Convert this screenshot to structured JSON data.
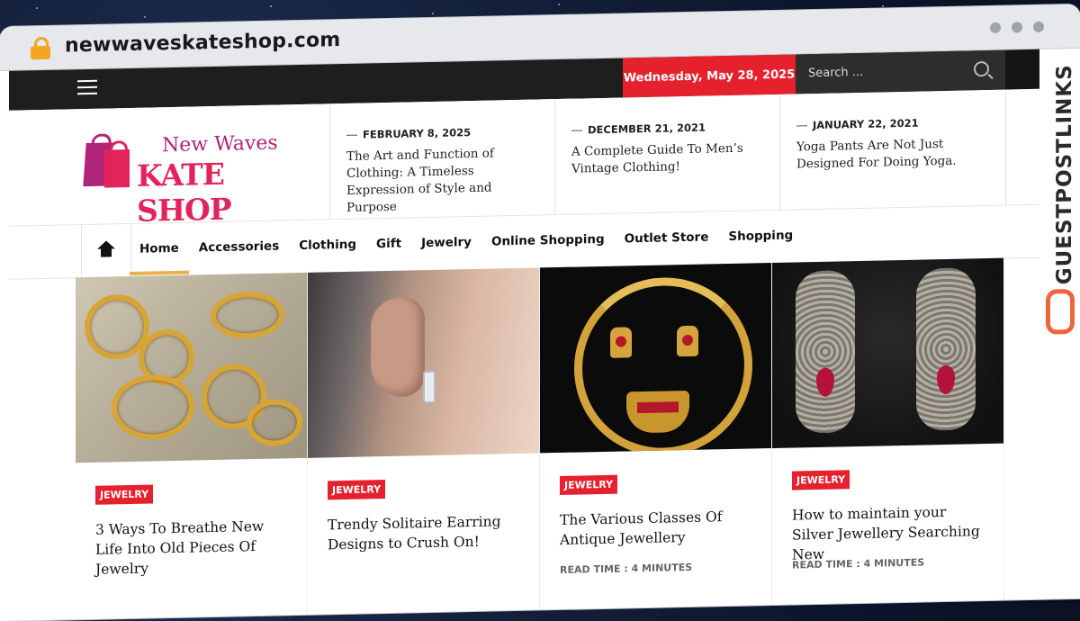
{
  "browser": {
    "url": "newwaveskateshop.com"
  },
  "topbar": {
    "date": "Wednesday, May 28, 2025",
    "search_placeholder": "Search ..."
  },
  "logo": {
    "line1": "New Waves",
    "line2": "KATE SHOP"
  },
  "headlines": [
    {
      "date": "FEBRUARY 8, 2025",
      "title": "The Art and Function of Clothing: A Timeless Expression of Style and Purpose"
    },
    {
      "date": "DECEMBER 21, 2021",
      "title": "A Complete Guide To Men’s Vintage Clothing!"
    },
    {
      "date": "JANUARY 22, 2021",
      "title": "Yoga Pants Are Not Just Designed For Doing Yoga."
    }
  ],
  "nav": {
    "items": [
      "Home",
      "Accessories",
      "Clothing",
      "Gift",
      "Jewelry",
      "Online Shopping",
      "Outlet Store",
      "Shopping"
    ]
  },
  "cards": [
    {
      "category": "JEWELRY",
      "title": "3 Ways To Breathe New Life Into Old Pieces Of Jewelry",
      "read_time": ""
    },
    {
      "category": "JEWELRY",
      "title": "Trendy Solitaire Earring Designs to Crush On!",
      "read_time": ""
    },
    {
      "category": "JEWELRY",
      "title": "The Various Classes Of Antique Jewellery",
      "read_time": "READ TIME : 4 MINUTES"
    },
    {
      "category": "JEWELRY",
      "title": "How to maintain your Silver Jewellery Searching New",
      "read_time": "READ TIME : 4 MINUTES"
    }
  ],
  "watermark": {
    "text": "GUESTPOSTLINKS"
  },
  "colors": {
    "accent_red": "#e5212e",
    "nav_underline": "#e8b14a",
    "topbar": "#1e1e1e"
  }
}
